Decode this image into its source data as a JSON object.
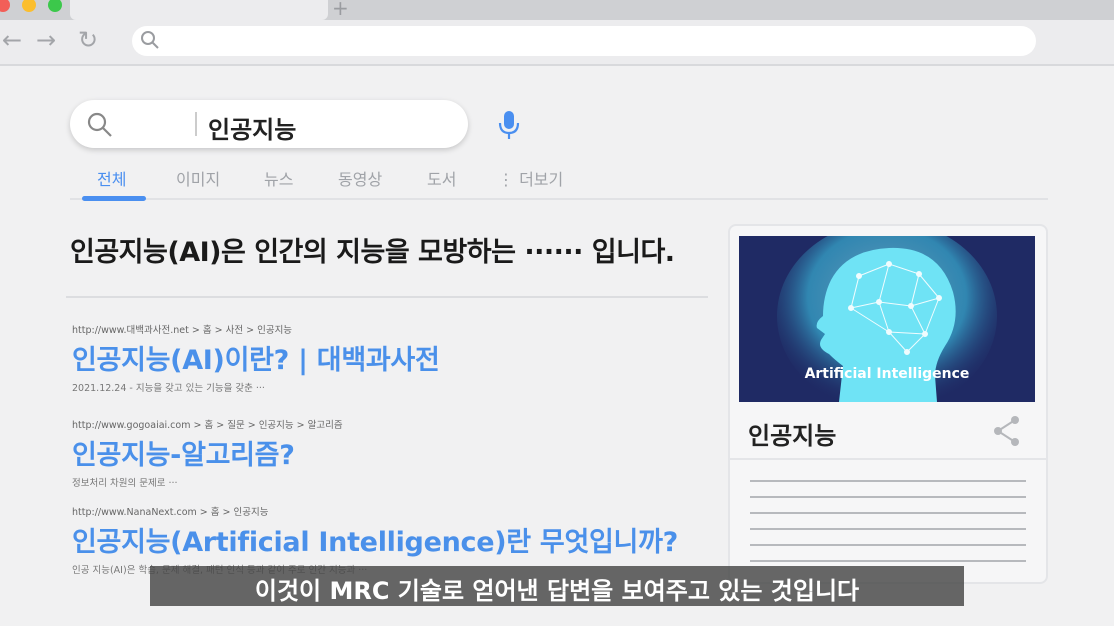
{
  "browser": {
    "new_tab_symbol": "+",
    "back_symbol": "←",
    "forward_symbol": "→",
    "reload_symbol": "↻",
    "address_value": ""
  },
  "search": {
    "query": "인공지능"
  },
  "tabs": [
    "전체",
    "이미지",
    "뉴스",
    "동영상",
    "도서",
    "⋮ 더보기"
  ],
  "answer": {
    "text": "인공지능(AI)은 인간의 지능을 모방하는 ······ 입니다."
  },
  "results": [
    {
      "url": "http://www.대백과사전.net > 홈 > 사전 > 인공지능",
      "title": "인공지능(AI)이란? | 대백과사전",
      "snippet": "2021.12.24 - 지능을 갖고 있는 기능을 갖춘 ···"
    },
    {
      "url": "http://www.gogoaiai.com > 홈 > 질문 > 인공지능 > 알고리즘",
      "title": "인공지능-알고리즘?",
      "snippet": "정보처리 차원의 문제로 ···"
    },
    {
      "url": "http://www.NanaNext.com > 홈 > 인공지능",
      "title": "인공지능(Artificial Intelligence)란 무엇입니까?",
      "snippet": "인공 지능(AI)은 학습, 문제 해결, 패턴 인식 등과 같이 주로 인간 지능과 ···"
    }
  ],
  "knowledge_panel": {
    "image_caption": "Artificial Intelligence",
    "title": "인공지능"
  },
  "caption": {
    "text": "이것이 MRC 기술로 얻어낸 답변을 보여주고 있는 것입니다"
  },
  "colors": {
    "accent": "#4a8ff0",
    "link": "#4a90ea",
    "panel_image_bg": "#1f2a64",
    "window_red": "#f25f58",
    "window_yellow": "#fbbe2e",
    "window_green": "#3cc84b"
  }
}
